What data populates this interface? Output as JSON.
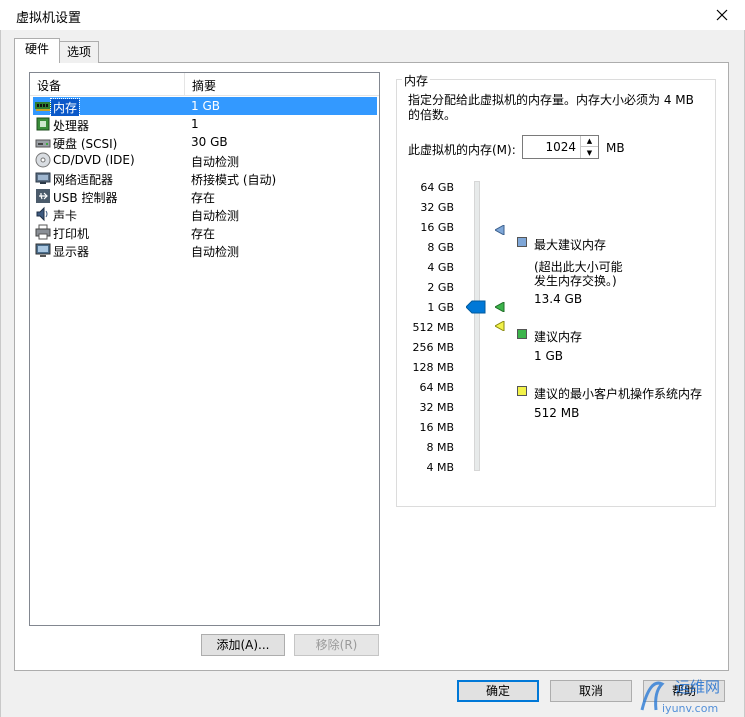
{
  "window": {
    "title": "虚拟机设置"
  },
  "tabs": [
    {
      "label": "硬件",
      "active": true
    },
    {
      "label": "选项",
      "active": false
    }
  ],
  "device_list": {
    "columns": [
      "设备",
      "摘要"
    ],
    "rows": [
      {
        "icon": "memory-icon",
        "name": "内存",
        "summary": "1 GB",
        "selected": true
      },
      {
        "icon": "processor-icon",
        "name": "处理器",
        "summary": "1"
      },
      {
        "icon": "harddisk-icon",
        "name": "硬盘 (SCSI)",
        "summary": "30 GB"
      },
      {
        "icon": "cd-dvd-icon",
        "name": "CD/DVD (IDE)",
        "summary": "自动检测"
      },
      {
        "icon": "network-adapter-icon",
        "name": "网络适配器",
        "summary": "桥接模式 (自动)"
      },
      {
        "icon": "usb-icon",
        "name": "USB 控制器",
        "summary": "存在"
      },
      {
        "icon": "sound-card-icon",
        "name": "声卡",
        "summary": "自动检测"
      },
      {
        "icon": "printer-icon",
        "name": "打印机",
        "summary": "存在"
      },
      {
        "icon": "display-icon",
        "name": "显示器",
        "summary": "自动检测"
      }
    ]
  },
  "list_buttons": {
    "add": "添加(A)...",
    "remove": "移除(R)"
  },
  "memory": {
    "group_title": "内存",
    "description": "指定分配给此虚拟机的内存量。内存大小必须为 4 MB 的倍数。",
    "field_label": "此虚拟机的内存(M):",
    "value": "1024",
    "unit": "MB",
    "scale_ticks": [
      "64 GB",
      "32 GB",
      "16 GB",
      "8 GB",
      "4 GB",
      "2 GB",
      "1 GB",
      "512 MB",
      "256 MB",
      "128 MB",
      "64 MB",
      "32 MB",
      "16 MB",
      "8 MB",
      "4 MB"
    ],
    "slider_value": "1 GB",
    "legend": {
      "max": {
        "label": "最大建议内存",
        "note_line1": "(超出此大小可能",
        "note_line2": "发生内存交换。)",
        "value": "13.4 GB",
        "color": "#7fa7d8"
      },
      "recommended": {
        "label": "建议内存",
        "value": "1 GB",
        "color": "#3cb44b"
      },
      "min_guest": {
        "label": "建议的最小客户机操作系统内存",
        "value": "512 MB",
        "color": "#f2f24a"
      }
    }
  },
  "footer_buttons": {
    "ok": "确定",
    "cancel": "取消",
    "help": "帮助"
  },
  "watermark": {
    "text": "运维网",
    "sub": "iyunv.com"
  }
}
